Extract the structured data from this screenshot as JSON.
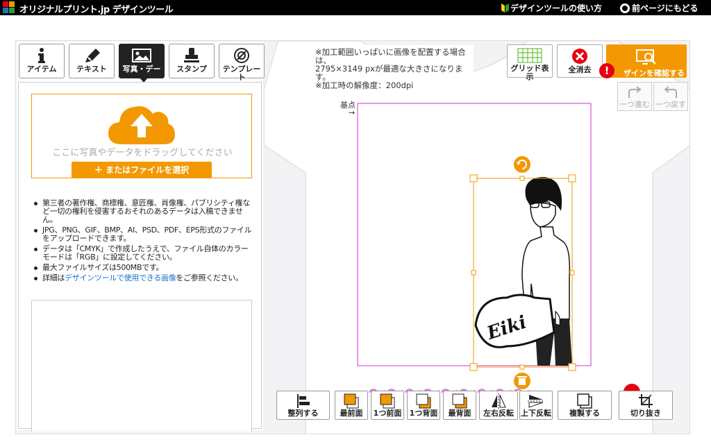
{
  "header": {
    "logo_text": "オリジナルプリント.jp デザインツール",
    "howto_label": "デザインツールの使い方",
    "back_label": "前ページにもどる"
  },
  "tabs": [
    {
      "label": "アイテム",
      "icon": "info-icon"
    },
    {
      "label": "テキスト",
      "icon": "pen-icon"
    },
    {
      "label": "写真・デー",
      "icon": "image-icon",
      "active": true
    },
    {
      "label": "スタンプ",
      "icon": "stamp-icon"
    },
    {
      "label": "テンプレー\nト",
      "icon": "template-icon"
    }
  ],
  "upload": {
    "drop_text": "ここに写真やデータをドラッグしてください",
    "select_label": "＋ またはファイルを選択"
  },
  "notes": [
    "第三者の著作権、商標権、意匠権、肖像権、パブリシティ権など一切の権利を侵害するおそれのあるデータは入稿できません。",
    "JPG、PNG、GIF、BMP、AI、PSD、PDF、EPS形式のファイルをアップロードできます。",
    "データは「CMYK」で作成したうえで、ファイル自体のカラーモードは「RGB」に設定してください。",
    "最大ファイルサイズは500MBです。"
  ],
  "note_link": {
    "prefix": "詳細は",
    "link": "デザインツールで使用できる画像",
    "suffix": "をご参照ください。"
  },
  "info": {
    "line1": "※加工範囲いっぱいに画像を配置する場合は、",
    "line2": "2795×3149 pxが最適な大きさになります。",
    "line3": "※加工時の解像度：200dpi"
  },
  "canvas": {
    "origin_label": "基点",
    "arrow": "→",
    "artwork_text": "Eiki"
  },
  "top_tools": {
    "grid_label": "グリッド表示",
    "clear_label": "全消去",
    "confirm_label": "ザインを確認する",
    "alert_mark": "!",
    "redo_label": "一つ進む",
    "undo_label": "一つ戻す"
  },
  "bottom_tools": [
    {
      "label": "整列する",
      "icon": "align-icon"
    },
    {
      "label": "最前面",
      "icon": "bring-front-icon"
    },
    {
      "label": "1つ前面",
      "icon": "bring-forward-icon"
    },
    {
      "label": "1つ背面",
      "icon": "send-backward-icon"
    },
    {
      "label": "最背面",
      "icon": "send-back-icon"
    },
    {
      "label": "左右反転",
      "icon": "flip-horizontal-icon"
    },
    {
      "label": "上下反転",
      "icon": "flip-vertical-icon"
    },
    {
      "label": "複製する",
      "icon": "duplicate-icon"
    },
    {
      "label": "切り抜き",
      "icon": "crop-icon"
    }
  ],
  "colors": {
    "accent": "#f39800",
    "alert": "#e60012",
    "guide": "#cc33cc",
    "link": "#1a73c9"
  }
}
